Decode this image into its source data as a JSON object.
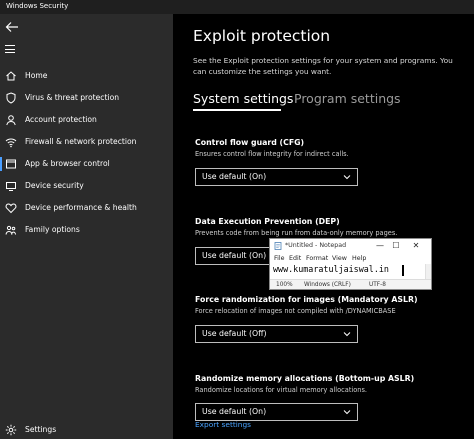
{
  "app": {
    "title": "Windows Security"
  },
  "sidebar": {
    "items": [
      {
        "label": "Home",
        "icon": "home-icon"
      },
      {
        "label": "Virus & threat protection",
        "icon": "shield-icon"
      },
      {
        "label": "Account protection",
        "icon": "person-icon"
      },
      {
        "label": "Firewall & network protection",
        "icon": "wifi-icon"
      },
      {
        "label": "App & browser control",
        "icon": "browser-window-icon",
        "active": true
      },
      {
        "label": "Device security",
        "icon": "device-icon"
      },
      {
        "label": "Device performance & health",
        "icon": "heart-icon"
      },
      {
        "label": "Family options",
        "icon": "family-icon"
      }
    ],
    "settings_label": "Settings"
  },
  "main": {
    "title": "Exploit protection",
    "description": "See the Exploit protection settings for your system and programs.  You can customize the settings you want.",
    "tabs": [
      {
        "label": "System settings",
        "active": true
      },
      {
        "label": "Program settings",
        "active": false
      }
    ],
    "sections": [
      {
        "heading": "Control flow guard (CFG)",
        "desc": "Ensures control flow integrity for indirect calls.",
        "value": "Use default (On)"
      },
      {
        "heading": "Data Execution Prevention (DEP)",
        "desc": "Prevents code from being run from data-only memory pages.",
        "value": "Use default (On)"
      },
      {
        "heading": "Force randomization for images (Mandatory ASLR)",
        "desc": "Force relocation of images not compiled with /DYNAMICBASE",
        "value": "Use default (Off)"
      },
      {
        "heading": "Randomize memory allocations (Bottom-up ASLR)",
        "desc": "Randomize locations for virtual memory allocations.",
        "value": "Use default (On)"
      }
    ],
    "export_label": "Export settings"
  },
  "notepad": {
    "title": "*Untitled - Notepad",
    "controls": {
      "minimize": "—",
      "maximize": "☐",
      "close": "✕"
    },
    "menu": [
      "File",
      "Edit",
      "Format",
      "View",
      "Help"
    ],
    "text": "www.kumaratuljaiswal.in",
    "status": {
      "zoom": "100%",
      "line_endings": "Windows (CRLF)",
      "encoding": "UTF-8"
    }
  },
  "colors": {
    "sidebar_bg": "#2b2b2b",
    "main_bg": "#000000",
    "accent": "#4a9eff",
    "link": "#4aa3ff"
  }
}
